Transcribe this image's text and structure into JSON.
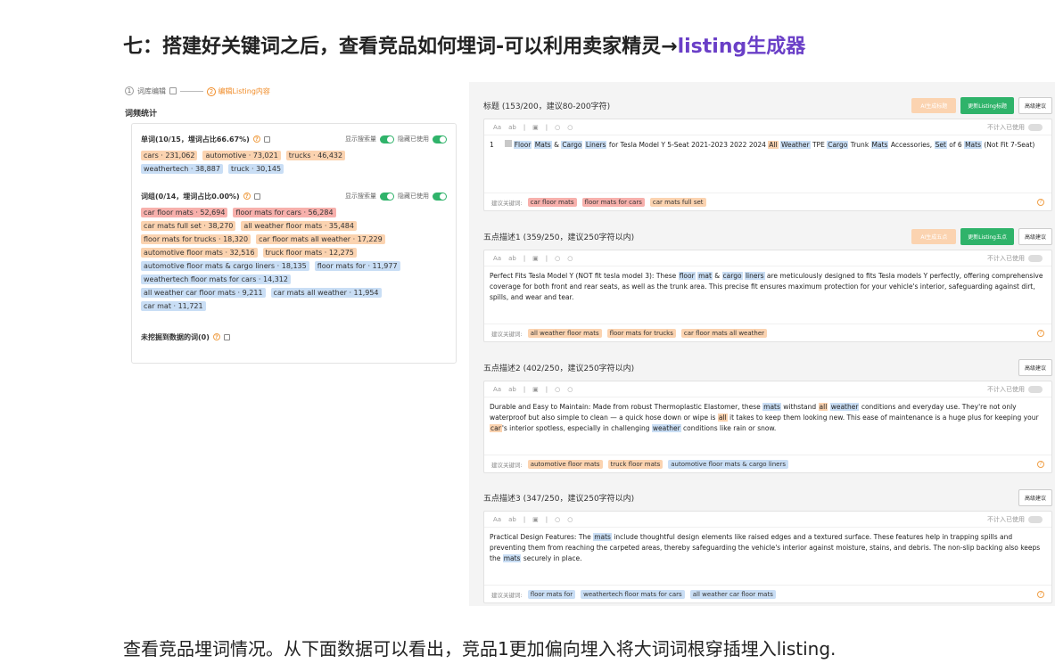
{
  "heading": {
    "main": "七：搭建好关键词之后，查看竞品如何埋词-可以利用卖家精灵→",
    "accent": "listing生成器",
    "accent_color": "#6a3fc7"
  },
  "left": {
    "step1": "词库编辑",
    "step2": "编辑Listing内容",
    "freq_title": "词频统计",
    "toggle1": "显示搜索量",
    "toggle2": "隐藏已使用",
    "single": {
      "title": "单词(10/15，埋词占比66.67%)",
      "chips": [
        {
          "t": "cars · 231,062",
          "c": "orange"
        },
        {
          "t": "automotive · 73,021",
          "c": "orange"
        },
        {
          "t": "trucks · 46,432",
          "c": "orange"
        },
        {
          "t": "weathertech · 38,887",
          "c": "blue"
        },
        {
          "t": "truck · 30,145",
          "c": "blue"
        }
      ]
    },
    "phrase": {
      "title": "词组(0/14，埋词占比0.00%)",
      "chips": [
        {
          "t": "car floor mats · 52,694",
          "c": "red"
        },
        {
          "t": "floor mats for cars · 56,284",
          "c": "red"
        },
        {
          "t": "car mats full set · 38,270",
          "c": "orange"
        },
        {
          "t": "all weather floor mats · 35,484",
          "c": "orange"
        },
        {
          "t": "floor mats for trucks · 18,320",
          "c": "orange"
        },
        {
          "t": "car floor mats all weather · 17,229",
          "c": "orange"
        },
        {
          "t": "automotive floor mats · 32,516",
          "c": "orange"
        },
        {
          "t": "truck floor mats · 12,275",
          "c": "orange"
        },
        {
          "t": "automotive floor mats & cargo liners · 18,135",
          "c": "blue"
        },
        {
          "t": "floor mats for · 11,977",
          "c": "blue"
        },
        {
          "t": "weathertech floor mats for cars · 14,312",
          "c": "blue"
        },
        {
          "t": "all weather car floor mats · 9,211",
          "c": "blue"
        },
        {
          "t": "car mats all weather · 11,954",
          "c": "blue"
        },
        {
          "t": "car mat · 11,721",
          "c": "blue"
        }
      ]
    },
    "unmined": "未挖掘到数据的词(0)"
  },
  "right": {
    "ai_title_btn": "AI生成标题",
    "ai_bullet_btn": "AI生成五点",
    "update_title_btn": "更新Listing标题",
    "update_bullet_btn": "更新Listing五点",
    "suggest_btn": "高级建议",
    "toolbar": {
      "aa": "Aa",
      "ab": "ab",
      "not_counted": "不计入已使用"
    },
    "kw_label": "建议关键词:",
    "title_section": {
      "label": "标题 (153/200，建议80-200字符)",
      "row_num": "1",
      "kws": [
        {
          "t": "car floor mats",
          "c": "red"
        },
        {
          "t": "floor mats for cars",
          "c": "red"
        },
        {
          "t": "car mats full set",
          "c": "orange"
        }
      ]
    },
    "b1": {
      "label": "五点描述1 (359/250，建议250字符以内)",
      "kws": [
        {
          "t": "all weather floor mats",
          "c": "orange"
        },
        {
          "t": "floor mats for trucks",
          "c": "orange"
        },
        {
          "t": "car floor mats all weather",
          "c": "orange"
        }
      ]
    },
    "b2": {
      "label": "五点描述2 (402/250，建议250字符以内)",
      "kws": [
        {
          "t": "automotive floor mats",
          "c": "orange"
        },
        {
          "t": "truck floor mats",
          "c": "orange"
        },
        {
          "t": "automotive floor mats & cargo liners",
          "c": "blue"
        }
      ]
    },
    "b3": {
      "label": "五点描述3 (347/250，建议250字符以内)",
      "kws": [
        {
          "t": "floor mats for",
          "c": "blue"
        },
        {
          "t": "weathertech floor mats for cars",
          "c": "blue"
        },
        {
          "t": "all weather car floor mats",
          "c": "blue"
        }
      ]
    }
  },
  "bottom_text": "查看竞品埋词情况。从下面数据可以看出，竞品1更加偏向埋入将大词词根穿插埋入listing."
}
